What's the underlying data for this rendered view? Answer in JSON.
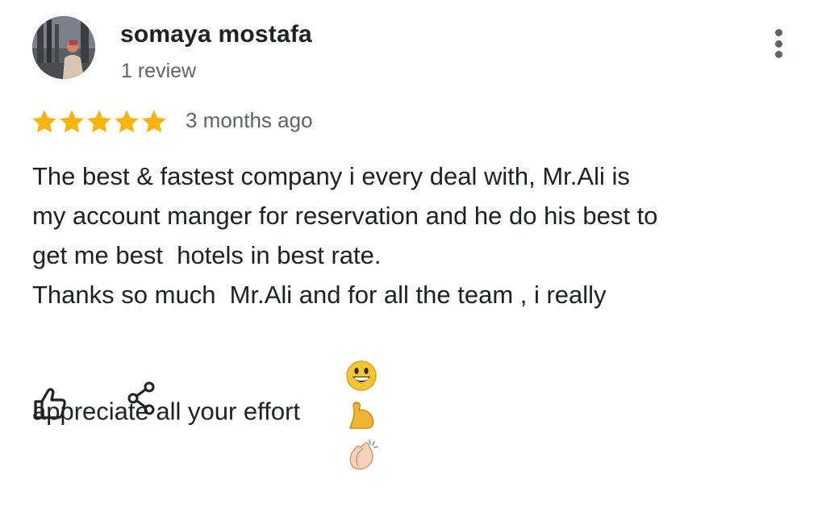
{
  "review": {
    "author_name": "somaya mostafa",
    "author_meta": "1 review",
    "rating": 5,
    "rating_max": 5,
    "date": "3 months ago",
    "text_lines": [
      "The best & fastest company i every deal with, Mr.Ali is",
      "my account manger for reservation and he do his best to",
      "get me best  hotels in best rate.",
      "Thanks so much  Mr.Ali and for all the team , i really",
      "appreciate all your effort"
    ],
    "emojis": [
      "grinning-face-emoji",
      "flexed-biceps-emoji",
      "clapping-hands-emoji"
    ]
  },
  "colors": {
    "star": "#f9b40d",
    "text": "#202124",
    "secondary_text": "#5f6368",
    "icon": "#202124"
  },
  "icons": {
    "more": "more-vertical-icon",
    "like": "thumbs-up-icon",
    "share": "share-icon"
  }
}
